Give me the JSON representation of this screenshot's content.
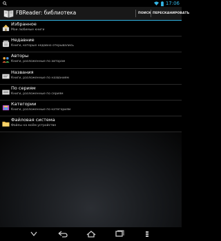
{
  "status_bar": {
    "time": "17:06"
  },
  "action_bar": {
    "title": "FBReader: библиотека",
    "search_label": "ПОИСК",
    "rescan_label": "ПЕРЕСКАНИРОВАТЬ"
  },
  "library": [
    {
      "title": "Избранное",
      "subtitle": "Мои любимые книги",
      "icon": "favorites-icon"
    },
    {
      "title": "Недавние",
      "subtitle": "Книги, которые недавно открывались",
      "icon": "recent-icon"
    },
    {
      "title": "Авторы",
      "subtitle": "Книги, разложенные по авторам",
      "icon": "authors-icon"
    },
    {
      "title": "Названия",
      "subtitle": "Книги, разложенные по названиям",
      "icon": "titles-icon"
    },
    {
      "title": "По сериям",
      "subtitle": "Книги, разложенные по сериям",
      "icon": "series-icon"
    },
    {
      "title": "Категории",
      "subtitle": "Книги, разложенные по категориям",
      "icon": "categories-icon"
    },
    {
      "title": "Файловая система",
      "subtitle": "Файлы на моём устройстве",
      "icon": "folder-icon"
    }
  ],
  "colors": {
    "accent": "#33b5e5",
    "background": "#000000",
    "action_bar": "#181818"
  }
}
